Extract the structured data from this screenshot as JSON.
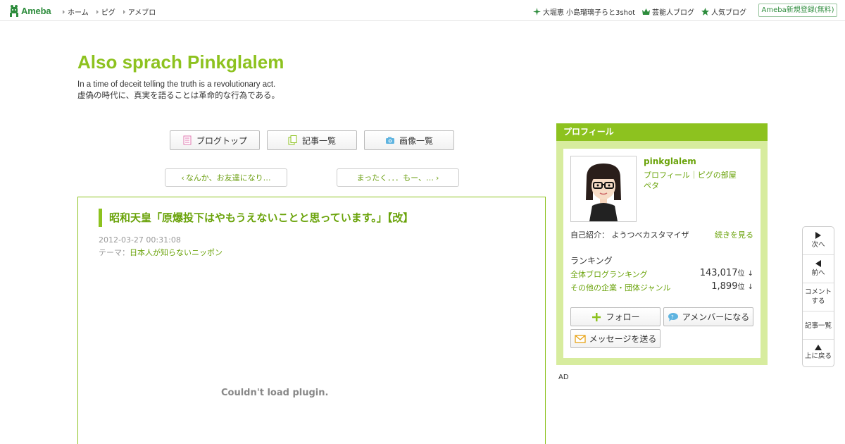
{
  "topbar": {
    "logo_text": "Ameba",
    "nav": [
      "ホーム",
      "ピグ",
      "アメブロ"
    ],
    "right_links": [
      "大堀恵 小島瑠璃子らと3shot",
      "芸能人ブログ",
      "人気ブログ"
    ],
    "signup_label": "Ameba新規登録(無料)"
  },
  "blog": {
    "title": "Also sprach Pinkglalem",
    "desc_en": "In a time of deceit telling the truth is a revolutionary act.",
    "desc_ja": "虚偽の時代に、真実を語ることは革命的な行為である。"
  },
  "nav_buttons": {
    "top": "ブログトップ",
    "list": "記事一覧",
    "images": "画像一覧"
  },
  "pager": {
    "prev": "なんか、お友達になり…",
    "next": "まったく．．．もー、…"
  },
  "entry": {
    "title": "昭和天皇「原爆投下はやもうえないことと思っています。」【改】",
    "date": "2012-03-27 00:31:08",
    "theme_prefix": "テーマ：",
    "theme": "日本人が知らないニッポン",
    "plugin_message": "Couldn't load plugin."
  },
  "profile": {
    "header": "プロフィール",
    "name": "pinkglalem",
    "link_profile": "プロフィール",
    "link_sep": "｜",
    "link_pig": "ピグの部屋",
    "link_peta": "ペタ",
    "intro": "自己紹介：  ようつべカスタマイザ",
    "more": "続きを見る",
    "ranking_label": "ランキング",
    "rankings": [
      {
        "name": "全体ブログランキング",
        "value": "143,017",
        "unit": "位",
        "arrow": "↓"
      },
      {
        "name": "その他の企業・団体ジャンル",
        "value": "1,899",
        "unit": "位",
        "arrow": "↓"
      }
    ],
    "follow": "フォロー",
    "amember": "アメンバーになる",
    "message": "メッセージを送る"
  },
  "ad_label": "AD",
  "sidenav": {
    "next": "次へ",
    "prev": "前へ",
    "comment1": "コメント",
    "comment2": "する",
    "list": "記事一覧",
    "top": "上に戻る"
  },
  "colors": {
    "accent": "#8dc21f",
    "link": "#6aa30a",
    "profile_bg": "#d7ec9e",
    "ameba_green": "#2d8c3c"
  }
}
